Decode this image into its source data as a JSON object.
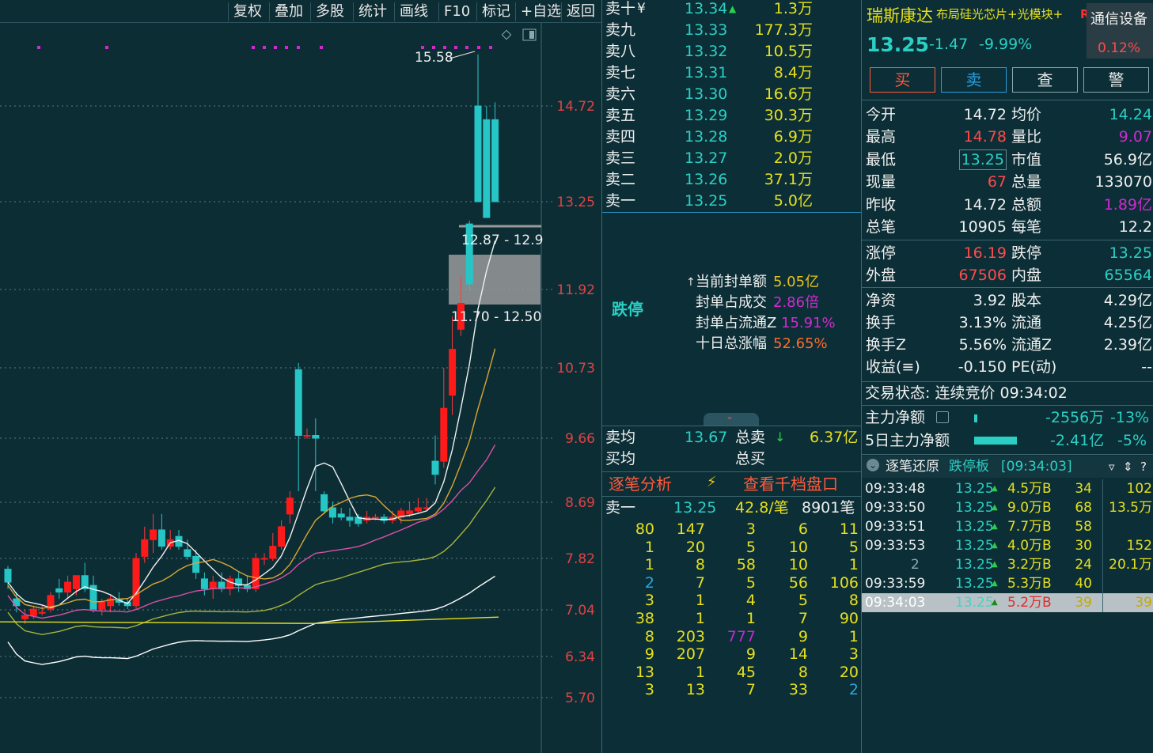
{
  "toolbar": {
    "buttons": [
      "复权",
      "叠加",
      "多股",
      "统计",
      "画线",
      "F10",
      "标记",
      "+自选",
      "返回"
    ]
  },
  "chart": {
    "y_ticks": [
      "14.72",
      "13.25",
      "11.92",
      "10.73",
      "9.66",
      "8.69",
      "7.82",
      "7.04",
      "6.34",
      "5.70"
    ],
    "peak_label": "15.58",
    "box_upper_label": "12.87 - 12.9",
    "box_lower_label": "11.70 - 12.50"
  },
  "chart_data": {
    "type": "candlestick",
    "y_ticks": [
      14.72,
      13.25,
      11.92,
      10.73,
      9.66,
      8.69,
      7.82,
      7.04,
      6.34,
      5.7
    ],
    "max_label": 15.58,
    "candles": [
      {
        "o": 7.65,
        "h": 7.7,
        "l": 7.35,
        "c": 7.45
      },
      {
        "o": 7.2,
        "h": 7.3,
        "l": 7.0,
        "c": 7.1
      },
      {
        "o": 6.9,
        "h": 7.05,
        "l": 6.82,
        "c": 6.95
      },
      {
        "o": 6.95,
        "h": 7.1,
        "l": 6.9,
        "c": 7.05
      },
      {
        "o": 7.0,
        "h": 7.1,
        "l": 6.95,
        "c": 7.0
      },
      {
        "o": 7.05,
        "h": 7.3,
        "l": 7.0,
        "c": 7.25
      },
      {
        "o": 7.35,
        "h": 7.5,
        "l": 7.2,
        "c": 7.3
      },
      {
        "o": 7.3,
        "h": 7.55,
        "l": 7.2,
        "c": 7.45
      },
      {
        "o": 7.35,
        "h": 7.55,
        "l": 7.25,
        "c": 7.55
      },
      {
        "o": 7.55,
        "h": 7.75,
        "l": 7.3,
        "c": 7.35
      },
      {
        "o": 7.4,
        "h": 7.55,
        "l": 7.0,
        "c": 7.05
      },
      {
        "o": 7.05,
        "h": 7.2,
        "l": 6.95,
        "c": 7.15
      },
      {
        "o": 7.1,
        "h": 7.25,
        "l": 7.0,
        "c": 7.2
      },
      {
        "o": 7.2,
        "h": 7.3,
        "l": 7.1,
        "c": 7.15
      },
      {
        "o": 7.15,
        "h": 7.2,
        "l": 7.05,
        "c": 7.1
      },
      {
        "o": 7.1,
        "h": 7.9,
        "l": 7.05,
        "c": 7.82
      },
      {
        "o": 7.85,
        "h": 8.3,
        "l": 7.75,
        "c": 8.1
      },
      {
        "o": 8.1,
        "h": 8.5,
        "l": 7.9,
        "c": 8.25
      },
      {
        "o": 8.25,
        "h": 8.5,
        "l": 7.95,
        "c": 8.0
      },
      {
        "o": 8.0,
        "h": 8.25,
        "l": 7.95,
        "c": 8.1
      },
      {
        "o": 8.15,
        "h": 8.25,
        "l": 7.95,
        "c": 8.0
      },
      {
        "o": 7.95,
        "h": 8.1,
        "l": 7.8,
        "c": 7.85
      },
      {
        "o": 7.85,
        "h": 7.95,
        "l": 7.5,
        "c": 7.6
      },
      {
        "o": 7.5,
        "h": 7.6,
        "l": 7.25,
        "c": 7.35
      },
      {
        "o": 7.35,
        "h": 7.55,
        "l": 7.2,
        "c": 7.45
      },
      {
        "o": 7.45,
        "h": 7.6,
        "l": 7.3,
        "c": 7.35
      },
      {
        "o": 7.35,
        "h": 7.55,
        "l": 7.25,
        "c": 7.5
      },
      {
        "o": 7.5,
        "h": 7.6,
        "l": 7.3,
        "c": 7.4
      },
      {
        "o": 7.4,
        "h": 7.55,
        "l": 7.3,
        "c": 7.35
      },
      {
        "o": 7.35,
        "h": 7.9,
        "l": 7.3,
        "c": 7.82
      },
      {
        "o": 7.82,
        "h": 7.9,
        "l": 7.72,
        "c": 7.82
      },
      {
        "o": 7.82,
        "h": 8.2,
        "l": 7.78,
        "c": 8.0
      },
      {
        "o": 8.0,
        "h": 8.4,
        "l": 7.95,
        "c": 8.3
      },
      {
        "o": 8.5,
        "h": 8.85,
        "l": 8.35,
        "c": 8.75
      },
      {
        "o": 10.7,
        "h": 10.8,
        "l": 8.85,
        "c": 9.7
      },
      {
        "o": 9.7,
        "h": 9.8,
        "l": 9.65,
        "c": 9.7
      },
      {
        "o": 9.7,
        "h": 9.95,
        "l": 8.85,
        "c": 9.66
      },
      {
        "o": 8.8,
        "h": 8.85,
        "l": 8.5,
        "c": 8.55
      },
      {
        "o": 8.6,
        "h": 8.7,
        "l": 8.35,
        "c": 8.45
      },
      {
        "o": 8.5,
        "h": 8.6,
        "l": 8.4,
        "c": 8.45
      },
      {
        "o": 8.45,
        "h": 8.6,
        "l": 8.3,
        "c": 8.4
      },
      {
        "o": 8.45,
        "h": 8.5,
        "l": 8.3,
        "c": 8.35
      },
      {
        "o": 8.4,
        "h": 8.55,
        "l": 8.35,
        "c": 8.45
      },
      {
        "o": 8.45,
        "h": 8.5,
        "l": 8.4,
        "c": 8.45
      },
      {
        "o": 8.45,
        "h": 8.5,
        "l": 8.35,
        "c": 8.4
      },
      {
        "o": 8.4,
        "h": 8.55,
        "l": 8.35,
        "c": 8.45
      },
      {
        "o": 8.45,
        "h": 8.6,
        "l": 8.35,
        "c": 8.55
      },
      {
        "o": 8.5,
        "h": 8.7,
        "l": 8.45,
        "c": 8.55
      },
      {
        "o": 8.55,
        "h": 8.75,
        "l": 8.5,
        "c": 8.6
      },
      {
        "o": 8.6,
        "h": 8.75,
        "l": 8.55,
        "c": 8.6
      },
      {
        "o": 9.3,
        "h": 9.7,
        "l": 8.95,
        "c": 9.1
      },
      {
        "o": 9.3,
        "h": 10.73,
        "l": 9.2,
        "c": 10.1
      },
      {
        "o": 10.3,
        "h": 11.5,
        "l": 10.0,
        "c": 11.0
      },
      {
        "o": 11.3,
        "h": 12.1,
        "l": 11.2,
        "c": 11.7
      },
      {
        "o": 12.9,
        "h": 12.95,
        "l": 11.9,
        "c": 12.0
      },
      {
        "o": 14.72,
        "h": 15.58,
        "l": 13.25,
        "c": 13.25
      },
      {
        "o": 14.5,
        "h": 14.72,
        "l": 13.0,
        "c": 13.0
      },
      {
        "o": 14.5,
        "h": 14.78,
        "l": 13.25,
        "c": 13.25
      }
    ],
    "ma_lines": [
      {
        "name": "MA5",
        "color": "#f0f0f0"
      },
      {
        "name": "MA10",
        "color": "#d9a632"
      },
      {
        "name": "MA20",
        "color": "#d94fa6"
      },
      {
        "name": "MA30",
        "color": "#a8b43a"
      },
      {
        "name": "MA60",
        "color": "#ffffff"
      },
      {
        "name": "MA250",
        "color": "#e6e01e"
      }
    ]
  },
  "order_book": {
    "asks": [
      {
        "label": "卖十",
        "price": "13.34",
        "vol": "1.3万",
        "mark": "¥"
      },
      {
        "label": "卖九",
        "price": "13.33",
        "vol": "177.3万"
      },
      {
        "label": "卖八",
        "price": "13.32",
        "vol": "10.5万"
      },
      {
        "label": "卖七",
        "price": "13.31",
        "vol": "8.4万"
      },
      {
        "label": "卖六",
        "price": "13.30",
        "vol": "16.6万"
      },
      {
        "label": "卖五",
        "price": "13.29",
        "vol": "30.3万"
      },
      {
        "label": "卖四",
        "price": "13.28",
        "vol": "6.9万"
      },
      {
        "label": "卖三",
        "price": "13.27",
        "vol": "2.0万"
      },
      {
        "label": "卖二",
        "price": "13.26",
        "vol": "37.1万"
      },
      {
        "label": "卖一",
        "price": "13.25",
        "vol": "5.0亿"
      }
    ],
    "limit_label": "跌停",
    "seal": {
      "rows": [
        {
          "label": "当前封单额",
          "value": "5.05亿"
        },
        {
          "label": "封单占成交",
          "value": "2.86倍"
        },
        {
          "label": "封单占流通Z",
          "value": "15.91%"
        },
        {
          "label": "十日总涨幅",
          "value": "52.65%"
        }
      ]
    },
    "summary": {
      "sell_avg_label": "卖均",
      "sell_avg": "13.67",
      "sell_total_label": "总卖",
      "sell_total": "6.37亿",
      "buy_avg_label": "买均",
      "buy_total_label": "总买"
    },
    "links": {
      "analysis": "逐笔分析",
      "depth": "查看千档盘口"
    },
    "ask1": {
      "label": "卖一",
      "price": "13.25",
      "per": "42.8/笔",
      "count": "8901笔"
    },
    "grid": [
      [
        "80",
        "147",
        "3",
        "6",
        "11"
      ],
      [
        "1",
        "20",
        "5",
        "10",
        "5"
      ],
      [
        "1",
        "8",
        "58",
        "10",
        "1"
      ],
      [
        "2",
        "7",
        "5",
        "56",
        "106"
      ],
      [
        "3",
        "1",
        "4",
        "5",
        "8"
      ],
      [
        "38",
        "1",
        "1",
        "7",
        "90"
      ],
      [
        "8",
        "203",
        "777",
        "9",
        "1"
      ],
      [
        "9",
        "207",
        "9",
        "14",
        "3"
      ],
      [
        "13",
        "1",
        "45",
        "8",
        "20"
      ],
      [
        "3",
        "13",
        "7",
        "33",
        "2"
      ]
    ]
  },
  "quote": {
    "name": "瑞斯康达",
    "concept": "布局硅光芯片+光模块+",
    "r_badge": "R",
    "industry": "通信设备",
    "industry_pct": "0.12%",
    "price": "13.25",
    "change": "-1.47",
    "change_pct": "-9.99%",
    "buttons": [
      "买",
      "卖",
      "查",
      "警"
    ],
    "stats": [
      {
        "l1": "今开",
        "v1": "14.72",
        "l2": "均价",
        "v2": "14.24"
      },
      {
        "l1": "最高",
        "v1": "14.78",
        "l2": "量比",
        "v2": "9.07"
      },
      {
        "l1": "最低",
        "v1": "13.25",
        "l2": "市值",
        "v2": "56.9亿"
      },
      {
        "l1": "现量",
        "v1": "67",
        "l2": "总量",
        "v2": "133070"
      },
      {
        "l1": "昨收",
        "v1": "14.72",
        "l2": "总额",
        "v2": "1.89亿"
      },
      {
        "l1": "总笔",
        "v1": "10905",
        "l2": "每笔",
        "v2": "12.2"
      },
      {
        "l1": "涨停",
        "v1": "16.19",
        "l2": "跌停",
        "v2": "13.25"
      },
      {
        "l1": "外盘",
        "v1": "67506",
        "l2": "内盘",
        "v2": "65564"
      },
      {
        "l1": "净资",
        "v1": "3.92",
        "l2": "股本",
        "v2": "4.29亿"
      },
      {
        "l1": "换手",
        "v1": "3.13%",
        "l2": "流通",
        "v2": "4.25亿"
      },
      {
        "l1": "换手Z",
        "v1": "5.56%",
        "l2": "流通Z",
        "v2": "2.39亿"
      },
      {
        "l1": "收益(≡)",
        "v1": "-0.150",
        "l2": "PE(动)",
        "v2": "--"
      }
    ],
    "trade_state": "交易状态: 连续竞价 09:34:02",
    "main_flow": {
      "label": "主力净额",
      "value": "-2556万",
      "pct": "-13%"
    },
    "main_flow5": {
      "label": "5日主力净额",
      "value": "-2.41亿",
      "pct": "-5%"
    },
    "ticks_header": {
      "title": "逐笔还原",
      "board": "跌停板",
      "time": "[09:34:03]"
    },
    "ticks": [
      {
        "time": "09:33:48",
        "price": "13.25",
        "vol": "4.5万B",
        "n": "34",
        "side": "102"
      },
      {
        "time": "09:33:50",
        "price": "13.25",
        "vol": "9.0万B",
        "n": "68",
        "side": "13.5万"
      },
      {
        "time": "09:33:51",
        "price": "13.25",
        "vol": "7.7万B",
        "n": "58",
        "side": ""
      },
      {
        "time": "09:33:53",
        "price": "13.25",
        "vol": "4.0万B",
        "n": "30",
        "side": "152"
      },
      {
        "time": "2",
        "price": "13.25",
        "vol": "3.2万B",
        "n": "24",
        "side": "20.1万"
      },
      {
        "time": "09:33:59",
        "price": "13.25",
        "vol": "5.3万B",
        "n": "40",
        "side": ""
      },
      {
        "time": "09:34:03",
        "price": "13.25",
        "vol": "5.2万B",
        "n": "39",
        "side": "39"
      }
    ]
  },
  "colors": {
    "background": "#0c2e36",
    "up": "#ff1a1a",
    "down": "#26c6c6",
    "price_green": "#2ad0c4",
    "yellow": "#e6e01e",
    "red_text": "#ff4b4b",
    "magenta": "#d22ad2"
  }
}
